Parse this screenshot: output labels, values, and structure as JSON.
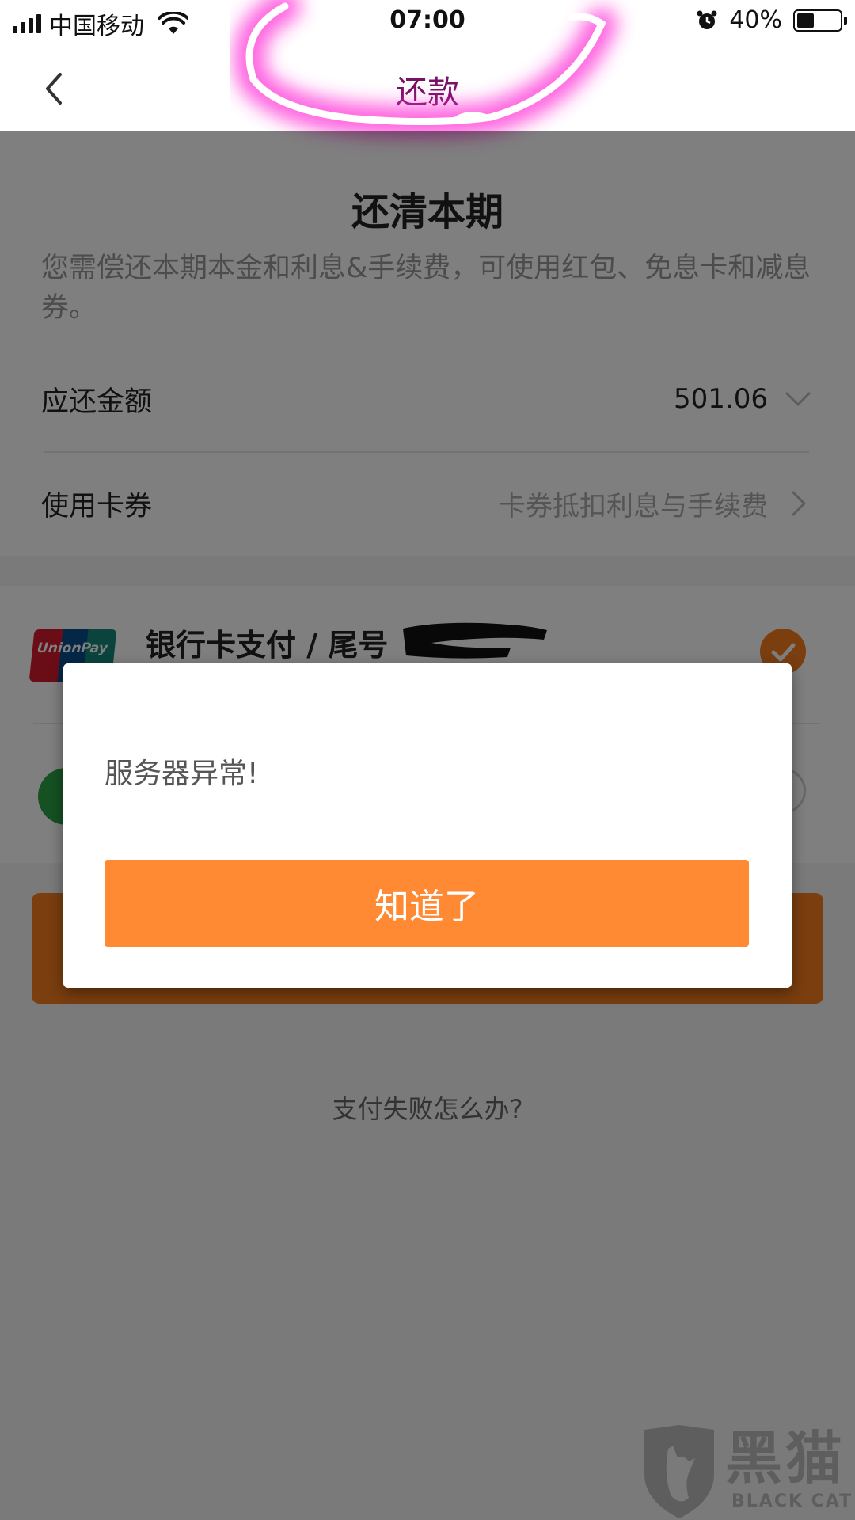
{
  "status_bar": {
    "carrier": "中国移动",
    "time": "07:00",
    "battery": "40%",
    "battery_level": 0.4
  },
  "nav": {
    "title": "还款"
  },
  "repay": {
    "title": "还清本期",
    "description": "您需偿还本期本金和利息&手续费，可使用红包、免息卡和减息券。",
    "amount_label": "应还金额",
    "amount_value": "501.06",
    "coupon_label": "使用卡券",
    "coupon_hint": "卡券抵扣利息与手续费"
  },
  "payment": {
    "bank_logo_text": "UnionPay",
    "bank_label": "银行卡支付 / 尾号"
  },
  "help_link": "支付失败怎么办?",
  "dialog": {
    "message": "服务器异常!",
    "button": "知道了"
  },
  "watermark": {
    "name": "黑猫",
    "sub": "BLACK CAT"
  },
  "colors": {
    "accent": "#f47d1f",
    "dialog_button": "#ff8a33",
    "annotation": "#ff2fd6",
    "nav_title": "#7a1068"
  }
}
